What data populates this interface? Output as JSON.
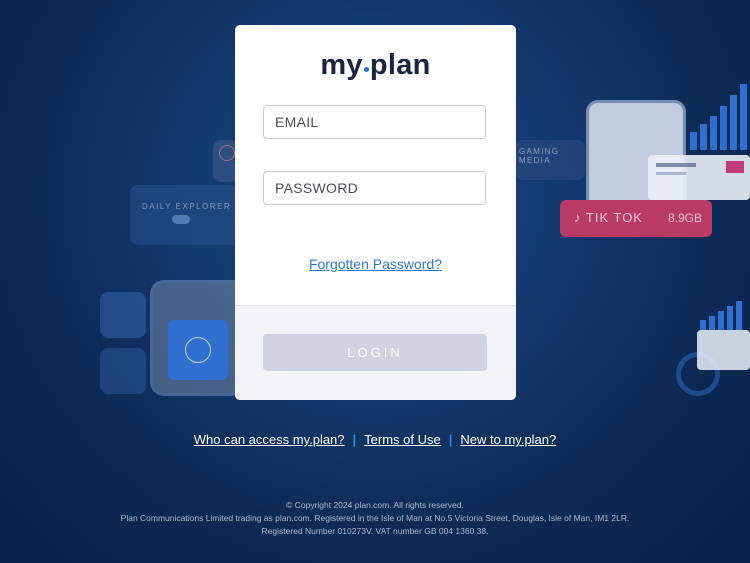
{
  "brand": {
    "logo_part1": "my",
    "logo_part2": "plan",
    "accent": "#2f6fd0"
  },
  "background_cards": {
    "daily_explorer": "DAILY EXPLORER",
    "gaming_media": "GAMING MEDIA",
    "tiktok_name": "TIK TOK",
    "tiktok_amount": "8.9GB"
  },
  "login_form": {
    "email_placeholder": "EMAIL",
    "password_placeholder": "PASSWORD",
    "forgot_link": "Forgotten Password?",
    "login_button": "LOGIN"
  },
  "footer_links": {
    "who_can_access": "Who can access my.plan?",
    "terms": "Terms of Use",
    "new_to": "New to my.plan?",
    "separator": "|"
  },
  "footer_text": {
    "copyright": "© Copyright 2024 plan.com. All rights reserved.",
    "registered": "Plan Communications Limited trading as plan.com. Registered in the Isle of Man at No.5 Victoria Street, Douglas, Isle of Man, IM1 2LR.",
    "numbers": "Registered Number 010273V. VAT number GB 004 1360 38."
  }
}
